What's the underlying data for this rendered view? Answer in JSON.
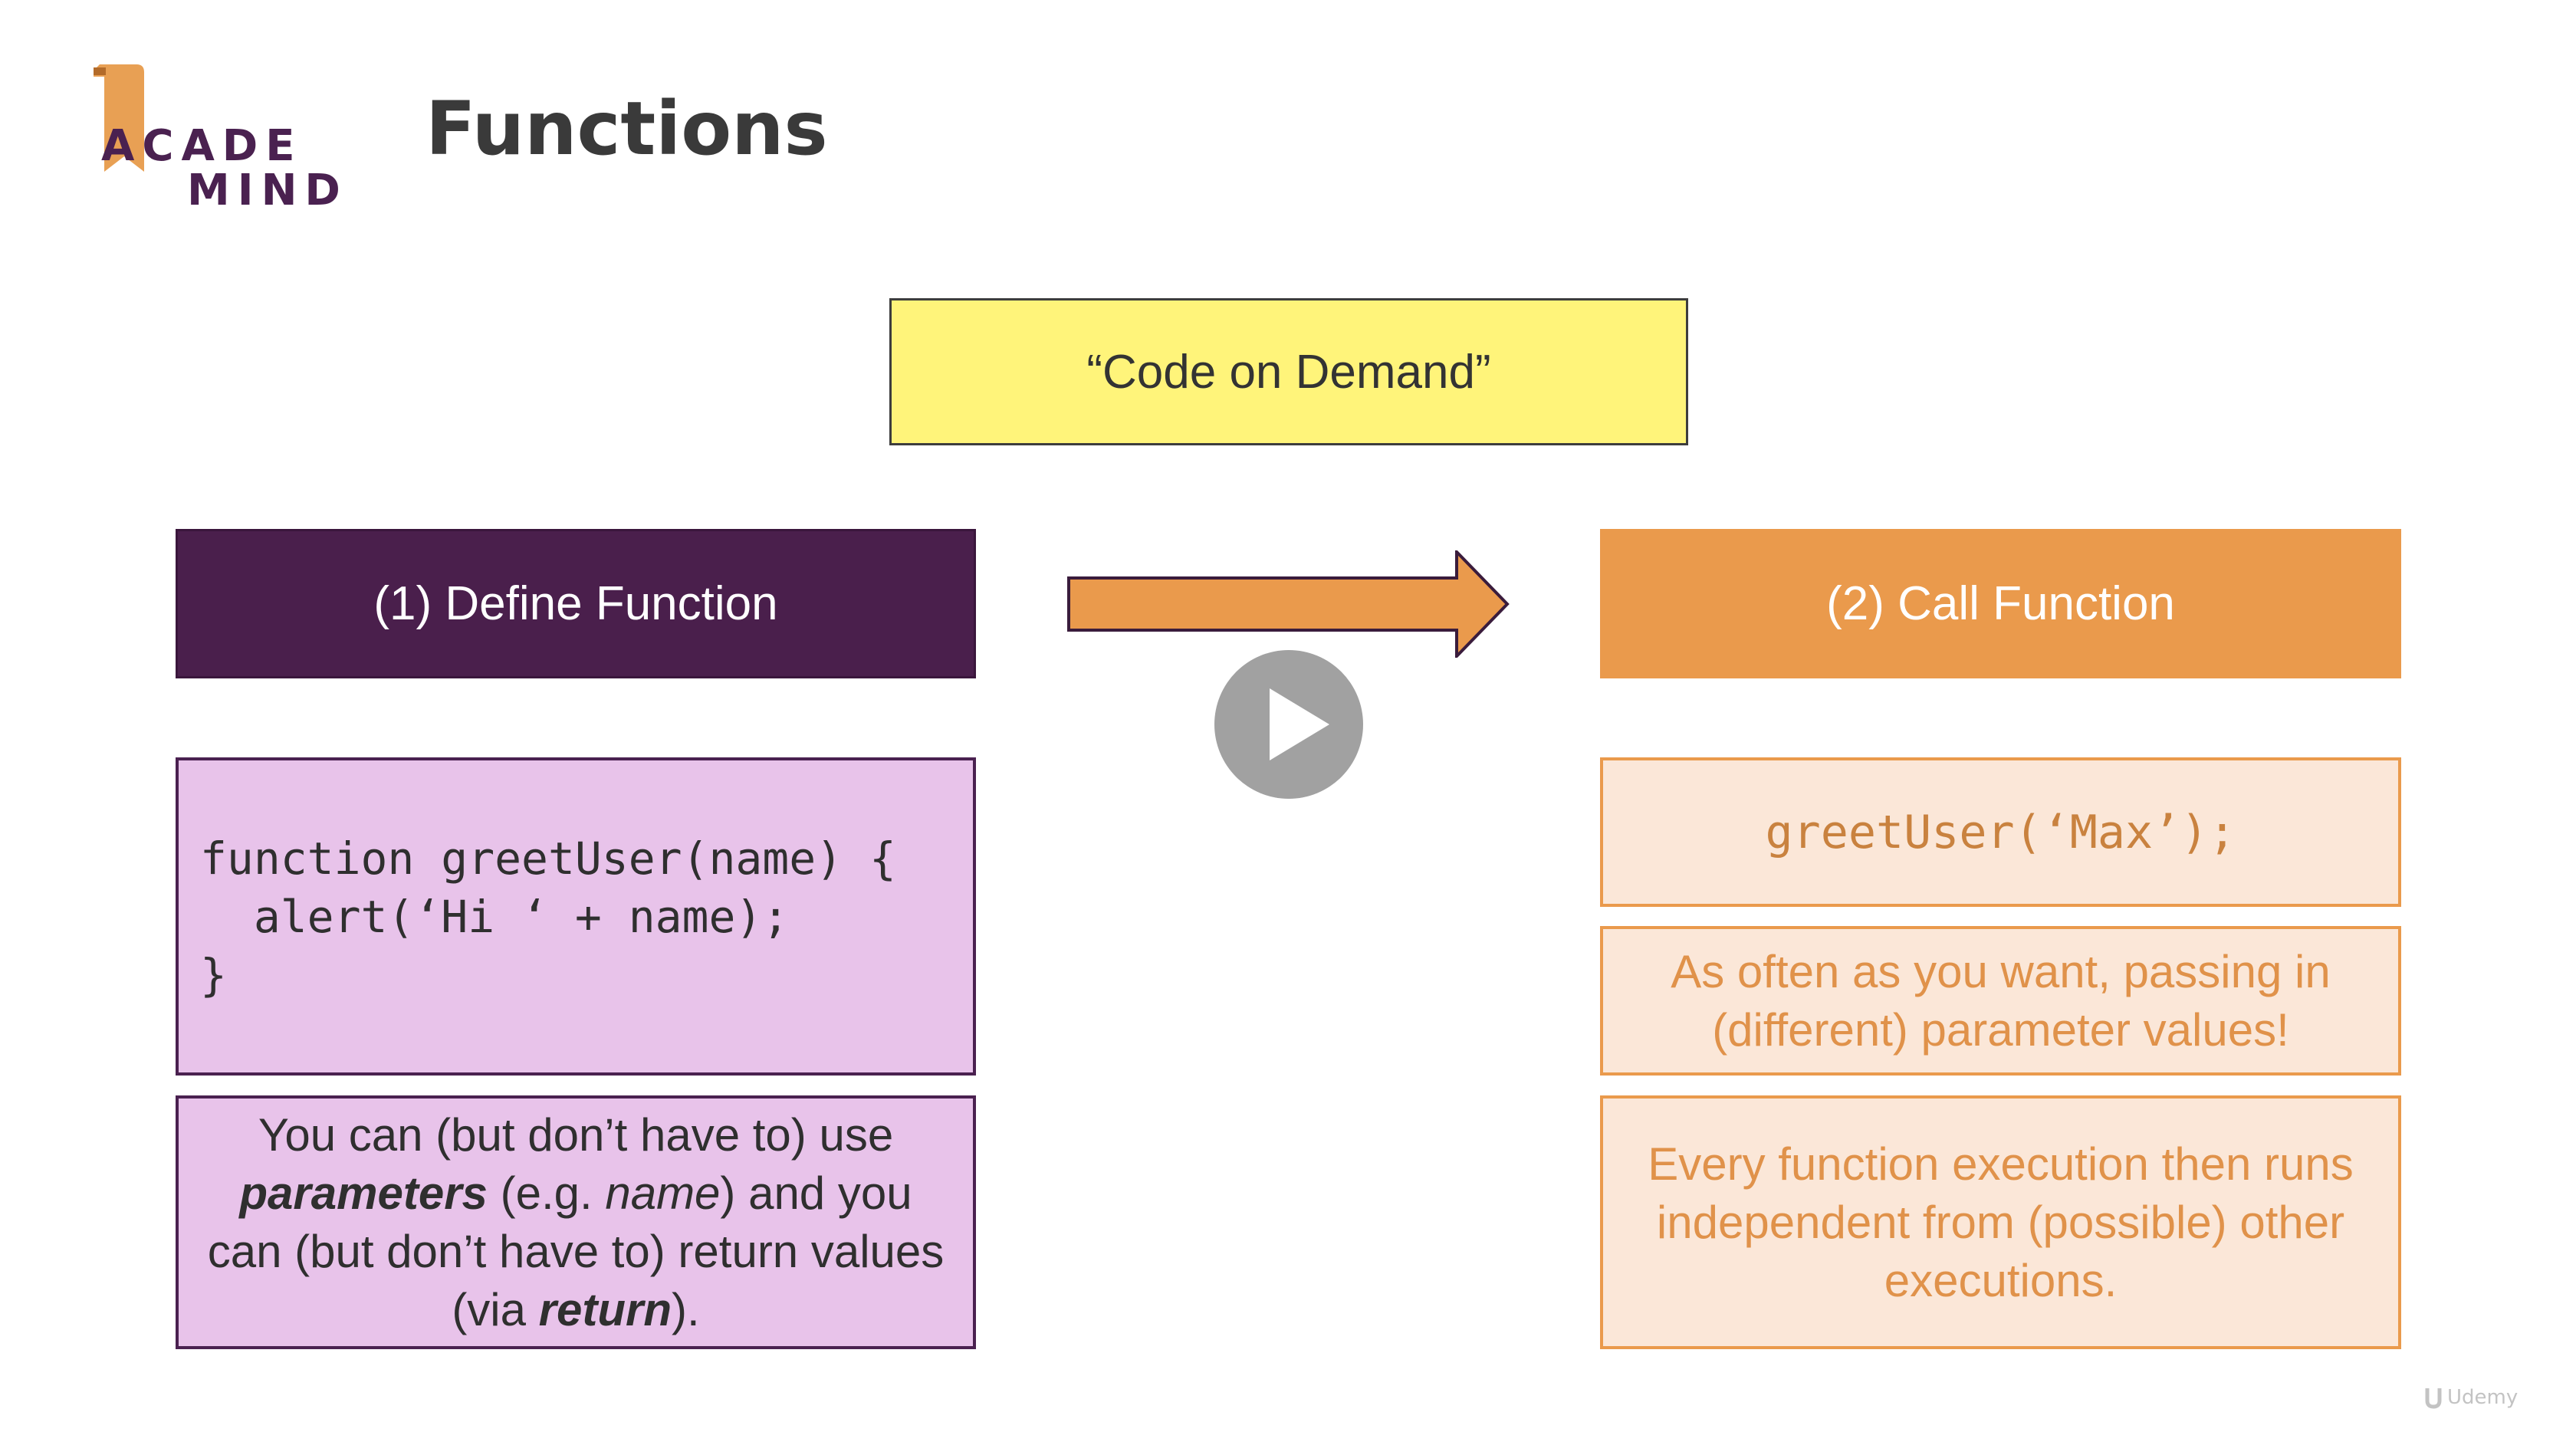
{
  "logo": {
    "line1": "ACADE",
    "line2": "MIND",
    "colors": {
      "flag": "#e8a054",
      "text": "#4a2150"
    }
  },
  "title": "Functions",
  "demand_label": "“Code on Demand”",
  "define": {
    "heading": "(1) Define Function",
    "code_lines": [
      "function greetUser(name) {",
      "  alert(‘Hi ‘ + name);",
      "}"
    ],
    "desc": {
      "part1": "You can (but don’t have to) use ",
      "parameters": "parameters",
      "part2": " (e.g. ",
      "name": "name",
      "part3": ") and you can (but don’t have to) return values (via ",
      "return": "return",
      "part4": ")."
    }
  },
  "call": {
    "heading": "(2) Call Function",
    "code": "greetUser(‘Max’);",
    "info1": "As often as you want, passing in (different) parameter values!",
    "info2": "Every function execution then runs independent from (possible) other executions."
  },
  "icons": {
    "arrow": "right-arrow-icon",
    "play": "play-icon"
  },
  "colors": {
    "purple": "#4a1f4c",
    "light_purple": "#e8c3ea",
    "orange": "#ea9a4c",
    "light_orange": "#fbe7d8",
    "yellow": "#fff47a"
  }
}
